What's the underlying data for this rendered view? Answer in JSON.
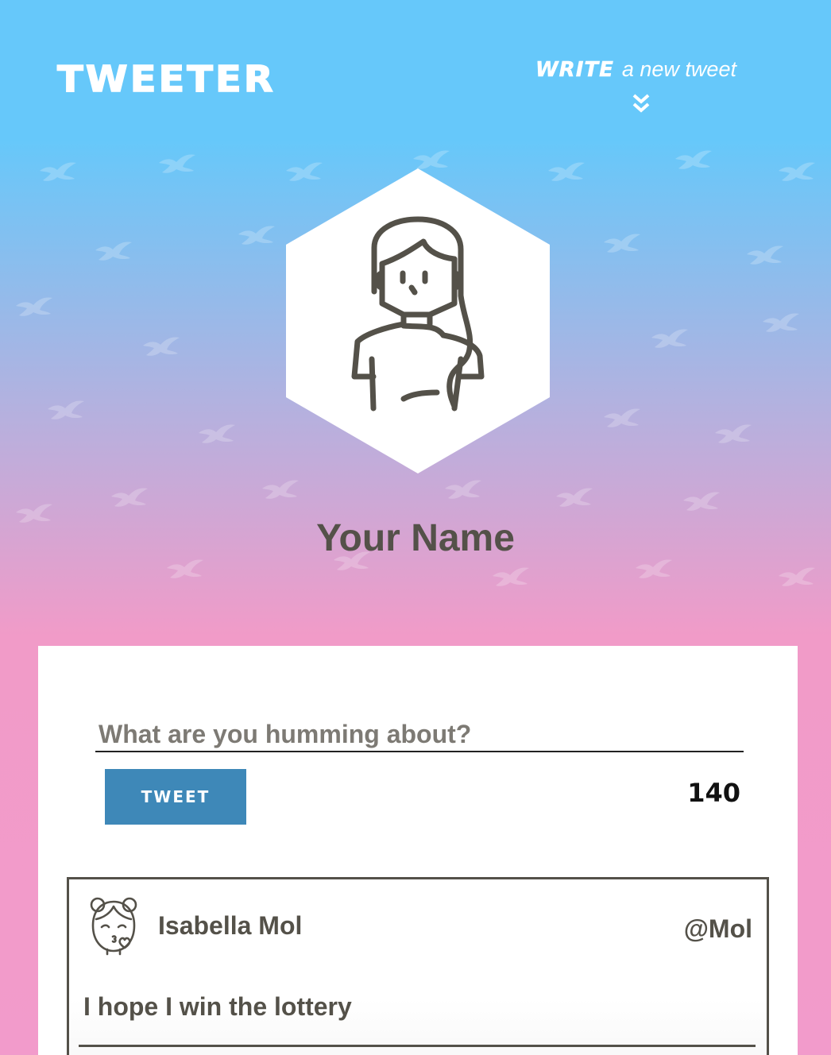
{
  "nav": {
    "logo": "TWEETER",
    "write_word": "WRITE",
    "write_rest": "a new tweet",
    "chevron_icon": "double-chevron-down-icon"
  },
  "profile": {
    "name": "Your Name",
    "avatar_icon": "woman-avatar-icon"
  },
  "compose": {
    "placeholder": "What are you humming about?",
    "button_label": "TWEET",
    "char_count": "140"
  },
  "tweets": [
    {
      "avatar_icon": "girl-kiss-avatar-icon",
      "name": "Isabella Mol",
      "handle": "@Mol",
      "text": "I hope I win the lottery"
    }
  ],
  "colors": {
    "nav_bg": "#66c8fa",
    "gradient_mid": "#b1b2e0",
    "gradient_bottom": "#f29bcb",
    "text_dark": "#545149",
    "button": "#3e88b8"
  }
}
